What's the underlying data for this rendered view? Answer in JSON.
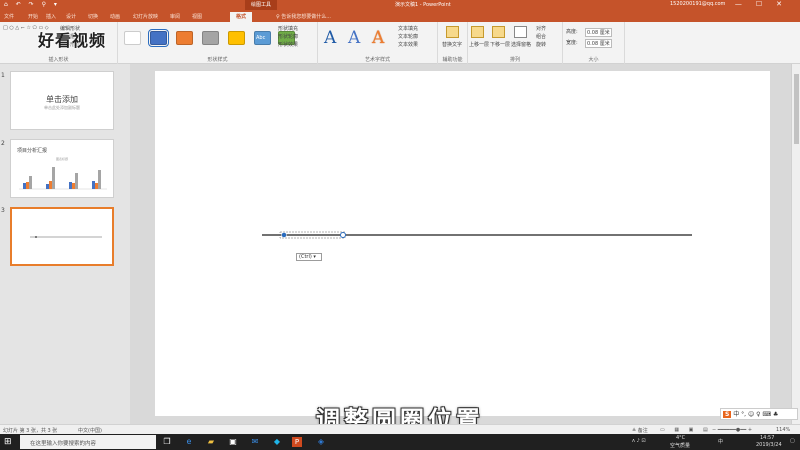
{
  "titlebar": {
    "quick_access": "⌂ ↶ ↷ ⚲ ▾",
    "context_tab": "绘图工具",
    "title": "演示文稿1 - PowerPoint",
    "account": "1520200191@qq.com",
    "window_controls": "—☐✕"
  },
  "tabs": [
    "文件",
    "开始",
    "插入",
    "设计",
    "切换",
    "动画",
    "幻灯片放映",
    "审阅",
    "视图",
    "格式"
  ],
  "active_tab": "格式",
  "tell_me": "♀ 告诉我您想要做什么...",
  "ribbon": {
    "groups": {
      "insert_shapes": "插入形状",
      "shape_styles": "形状样式",
      "wordart_styles": "艺术字样式",
      "accessibility": "辅助功能",
      "arrange": "排列",
      "size": "大小"
    },
    "edit_shape": "编辑形状",
    "textbox": "文本框",
    "merge_shapes": "合并形状",
    "shape_fill": "形状填充",
    "shape_outline": "形状轮廓",
    "shape_effects": "形状效果",
    "text_fill": "文本填充",
    "text_outline": "文本轮廓",
    "text_effects": "文本效果",
    "alt_text": "替换文字",
    "bring_forward": "上移一层",
    "send_backward": "下移一层",
    "selection_pane": "选择窗格",
    "align": "对齐",
    "group": "组合",
    "rotate": "旋转",
    "height_label": "高度:",
    "height_value": "0.08 厘米",
    "width_label": "宽度:",
    "width_value": "0.08 厘米",
    "abc": "Abc",
    "wordart_letter": "A"
  },
  "watermark": "好看视频",
  "thumbnails": [
    {
      "num": "1",
      "title": "单击添加",
      "subtitle": "单击此处添加副标题"
    },
    {
      "num": "2",
      "title": "项目分析汇报",
      "caption": "图表标题"
    },
    {
      "num": "3"
    }
  ],
  "context_tag": "(Ctrl) ▾",
  "subtitle": "调整圆圈位置",
  "ime": {
    "logo": "S",
    "text": "中 °, ☺ ♀ ⌨ ♣"
  },
  "statusbar": {
    "slide_info": "幻灯片 第 3 张，共 3 张",
    "lang": "中文(中国)",
    "notes": "≜ 备注",
    "zoom": "114%"
  },
  "taskbar": {
    "search_placeholder": "在这里输入你要搜索的内容",
    "time": "14:57",
    "date": "2019/3/24",
    "weather": "4°C",
    "weather_text": "空气质量",
    "lang": "中"
  },
  "colors": {
    "accent": "#c5532a",
    "swatches": [
      "#ffffff",
      "#4472c4",
      "#ed7d31",
      "#a5a5a5",
      "#ffc000",
      "#5b9bd5",
      "#70ad47"
    ],
    "line": "#1f1f1f",
    "handle": "#2a6cbf",
    "chart_blue": "#4472c4",
    "chart_orange": "#ed7d31",
    "chart_gray": "#a5a5a5"
  }
}
